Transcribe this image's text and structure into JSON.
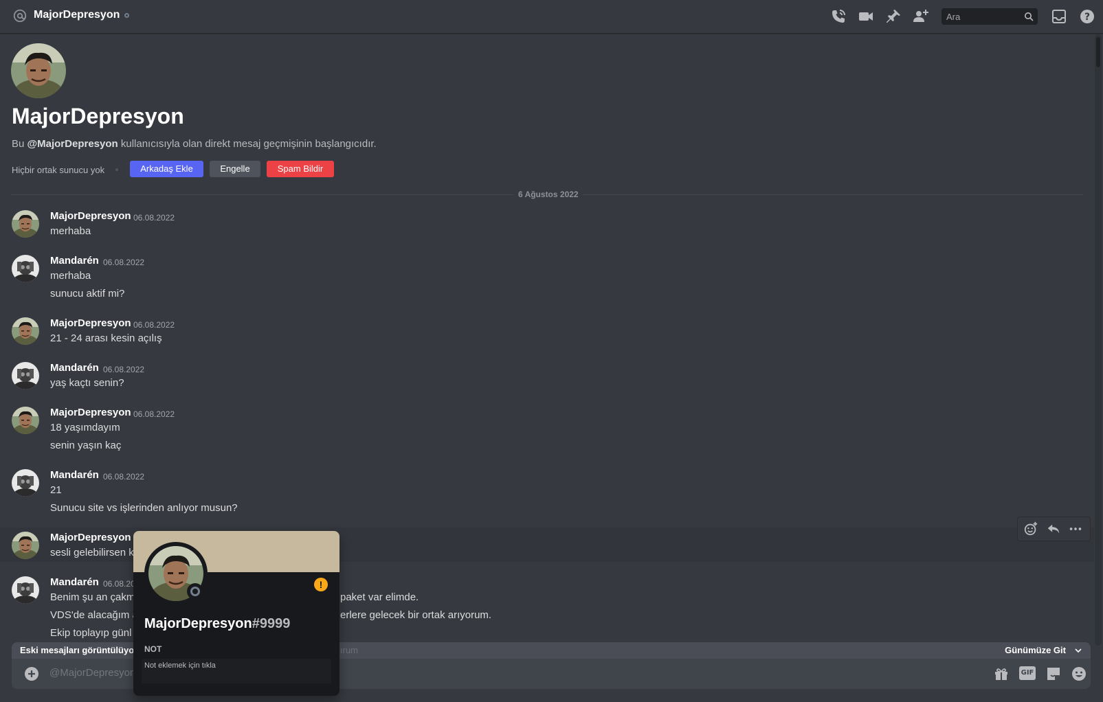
{
  "header": {
    "title": "MajorDepresyon",
    "icons": [
      "at-icon",
      "call-icon",
      "video-icon",
      "pin-icon",
      "add-member-icon",
      "inbox-icon",
      "help-icon"
    ],
    "search_placeholder": "Ara"
  },
  "profile_intro": {
    "name": "MajorDepresyon",
    "intro_prefix": "Bu ",
    "intro_handle": "@MajorDepresyon",
    "intro_suffix": " kullanıcısıyla olan direkt mesaj geçmişinin başlangıcıdır.",
    "mutual_servers": "Hiçbir ortak sunucu yok",
    "add_friend_label": "Arkadaş Ekle",
    "block_label": "Engelle",
    "report_spam_label": "Spam Bildir"
  },
  "date_divider": "6 Ağustos 2022",
  "messages": [
    {
      "author": "MajorDepresyon",
      "timestamp": "06.08.2022",
      "lines": [
        "merhaba"
      ]
    },
    {
      "author": "Mandarén",
      "timestamp": "06.08.2022",
      "lines": [
        "merhaba",
        "sunucu aktif mi?"
      ]
    },
    {
      "author": "MajorDepresyon",
      "timestamp": "06.08.2022",
      "lines": [
        "21 - 24 arası kesin açılış"
      ]
    },
    {
      "author": "Mandarén",
      "timestamp": "06.08.2022",
      "lines": [
        "yaş kaçtı senin?"
      ]
    },
    {
      "author": "MajorDepresyon",
      "timestamp": "06.08.2022",
      "lines": [
        "18  yaşımdayım",
        "senin yaşın kaç"
      ]
    },
    {
      "author": "Mandarén",
      "timestamp": "06.08.2022",
      "lines": [
        "21",
        "Sunucu site vs işlerinden anlıyor musun?"
      ]
    },
    {
      "author": "MajorDepresyon",
      "timestamp": "",
      "lines": [
        "sesli gelebilirsen k"
      ]
    },
    {
      "author": "Mandarén",
      "timestamp": "06.08.20",
      "lines": [
        "Benim şu an çakm",
        "VDS'de alacağım a",
        "Ekip toplayıp günl"
      ]
    }
  ],
  "message_tails": {
    "line1": "paket var elimde.",
    "line2": "erlere gelecek bir ortak arıyorum.",
    "faded": "ırum"
  },
  "old_messages_bar": {
    "left": "Eski mesajları görüntülüyors",
    "right": "Günümüze Git"
  },
  "composer": {
    "placeholder": "@MajorDepresyon",
    "icons": [
      "gift-icon",
      "gif-icon",
      "sticker-icon",
      "emoji-icon"
    ],
    "gif_label": "GIF"
  },
  "popout": {
    "username": "MajorDepresyon",
    "discriminator": "#9999",
    "note_title": "NOT",
    "note_placeholder": "Not eklemek için tıkla",
    "banner_color": "#c6b99d"
  },
  "colors": {
    "accent": "#5865f2",
    "danger": "#ed4245",
    "neutral_button": "#4f545c",
    "warning": "#faa81a"
  }
}
